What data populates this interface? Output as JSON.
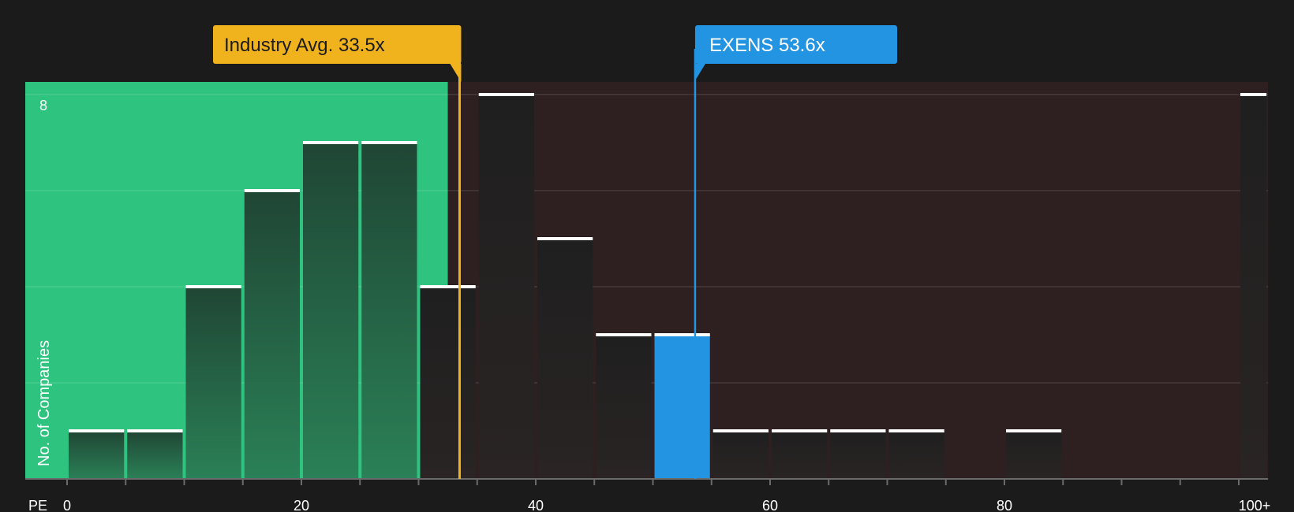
{
  "chart_data": {
    "type": "bar",
    "title": "",
    "xlabel": "PE",
    "ylabel": "No. of Companies",
    "xlim": [
      0,
      102.5
    ],
    "ylim": [
      0,
      8.3
    ],
    "bin_width": 5,
    "bins": [
      {
        "x0": 0,
        "x1": 5,
        "value": 1
      },
      {
        "x0": 5,
        "x1": 10,
        "value": 1
      },
      {
        "x0": 10,
        "x1": 15,
        "value": 4
      },
      {
        "x0": 15,
        "x1": 20,
        "value": 6
      },
      {
        "x0": 20,
        "x1": 25,
        "value": 7
      },
      {
        "x0": 25,
        "x1": 30,
        "value": 7
      },
      {
        "x0": 30,
        "x1": 35,
        "value": 4
      },
      {
        "x0": 35,
        "x1": 40,
        "value": 8
      },
      {
        "x0": 40,
        "x1": 45,
        "value": 5
      },
      {
        "x0": 45,
        "x1": 50,
        "value": 3
      },
      {
        "x0": 50,
        "x1": 55,
        "value": 3,
        "highlight": true
      },
      {
        "x0": 55,
        "x1": 60,
        "value": 1
      },
      {
        "x0": 60,
        "x1": 65,
        "value": 1
      },
      {
        "x0": 65,
        "x1": 70,
        "value": 1
      },
      {
        "x0": 70,
        "x1": 75,
        "value": 1
      },
      {
        "x0": 80,
        "x1": 85,
        "value": 1
      },
      {
        "x0": 100,
        "x1": 102.5,
        "value": 8
      }
    ],
    "x_ticks": [
      0,
      5,
      10,
      15,
      20,
      25,
      30,
      35,
      40,
      45,
      50,
      55,
      60,
      65,
      70,
      75,
      80,
      85,
      90,
      95,
      100
    ],
    "x_tick_labels": [
      {
        "value": 0,
        "label": "0"
      },
      {
        "value": 20,
        "label": "20"
      },
      {
        "value": 40,
        "label": "40"
      },
      {
        "value": 60,
        "label": "60"
      },
      {
        "value": 80,
        "label": "80"
      },
      {
        "value": 100,
        "label": "100+"
      }
    ],
    "y_gridlines": [
      2,
      4,
      6,
      8
    ],
    "y_tick_labels": [
      {
        "value": 8,
        "label": "8"
      }
    ],
    "fair_range_end": 32.5,
    "industry_avg": {
      "value": 33.5,
      "label": "Industry Avg. 33.5x"
    },
    "company": {
      "value": 53.6,
      "label": "EXENS 53.6x"
    },
    "colors": {
      "background": "#1b1b1b",
      "fair_zone": "#2ec47f",
      "over_zone": "#2e1f20",
      "bar_in_fair": "#1f4a36",
      "bar_over": "#262323",
      "highlight": "#2394e2",
      "industry": "#f0b31e",
      "company": "#2394e2",
      "cap": "#ffffff",
      "text": "#ffffff"
    }
  }
}
